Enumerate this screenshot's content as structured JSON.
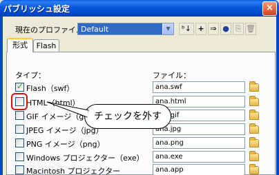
{
  "window": {
    "title": "パブリッシュ設定",
    "close_glyph": "×"
  },
  "profile": {
    "label": "現在のプロファイル：",
    "selected": "Default"
  },
  "toolbar": {
    "buttons": [
      "ᵇ↓",
      "+",
      "⇒",
      "●",
      "⎘",
      "🗑"
    ]
  },
  "tabs": [
    {
      "label": "形式",
      "active": true
    },
    {
      "label": "Flash",
      "active": false
    }
  ],
  "columns": {
    "type": "タイプ：",
    "file": "ファイル："
  },
  "rows": [
    {
      "label": "Flash（swf）",
      "checked": true,
      "file": "ana.swf"
    },
    {
      "label": "HTML（html）",
      "checked": false,
      "file": "ana.html"
    },
    {
      "label": "GIF イメージ（gif）",
      "checked": false,
      "file": "ana.gif"
    },
    {
      "label": "JPEG イメージ（jpg）",
      "checked": false,
      "file": "ana.jpg"
    },
    {
      "label": "PNG イメージ（png）",
      "checked": false,
      "file": "ana.png"
    },
    {
      "label": "Windows プロジェクター（exe）",
      "checked": false,
      "file": "ana.exe"
    },
    {
      "label": "Macintosh プロジェクター",
      "checked": false,
      "file": "ana.app"
    }
  ],
  "annotation": {
    "text": "チェックを外す",
    "color": "#e01010"
  }
}
